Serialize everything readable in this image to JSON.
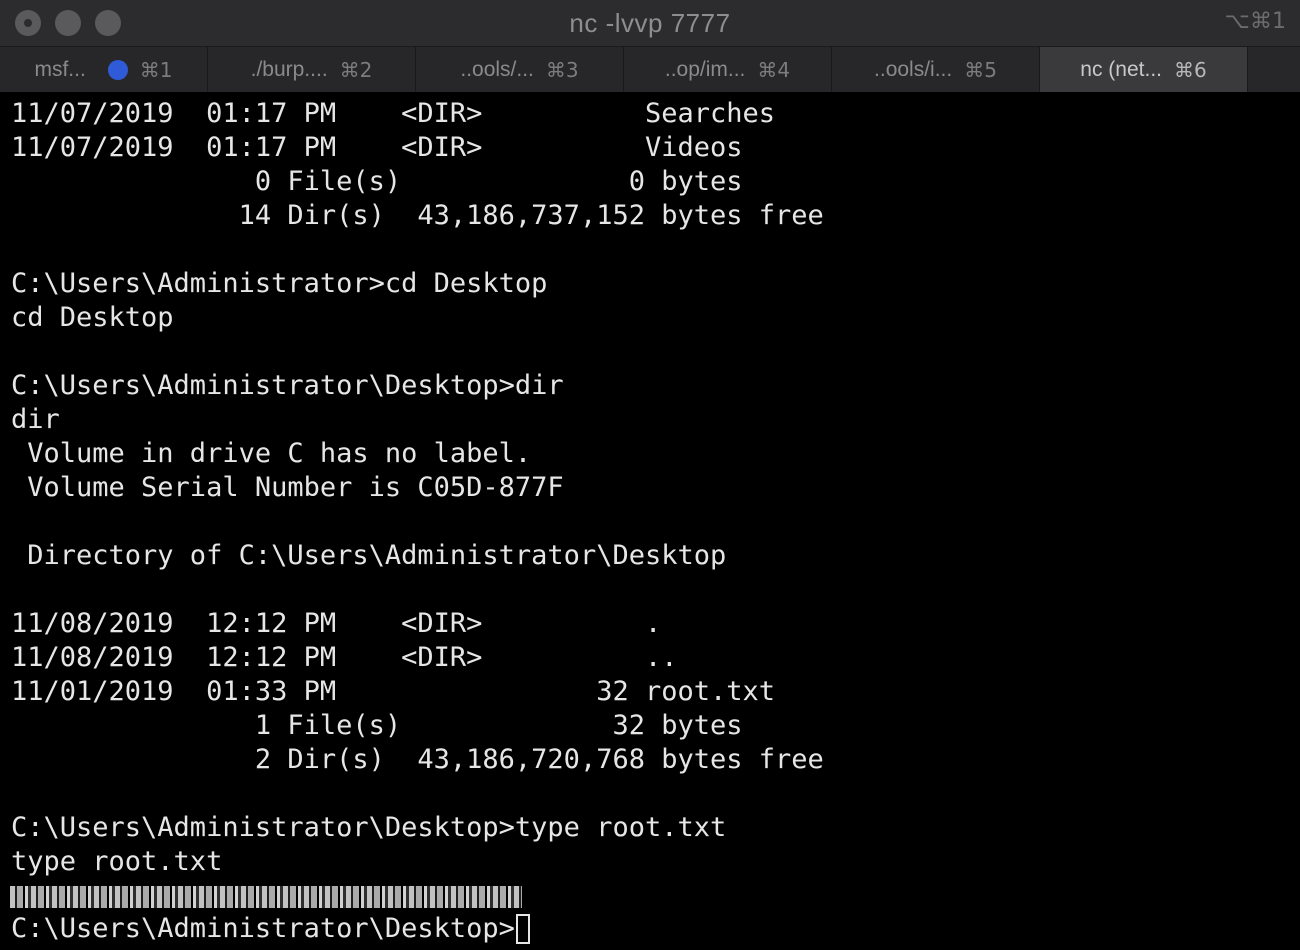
{
  "window": {
    "title": "nc -lvvp 7777",
    "shortcut": "⌥⌘1"
  },
  "tabs": [
    {
      "label": "msf...",
      "shortcut": "⌘1",
      "has_activity": true,
      "active": false
    },
    {
      "label": "./burp....",
      "shortcut": "⌘2",
      "has_activity": false,
      "active": false
    },
    {
      "label": "..ools/...",
      "shortcut": "⌘3",
      "has_activity": false,
      "active": false
    },
    {
      "label": "..op/im...",
      "shortcut": "⌘4",
      "has_activity": false,
      "active": false
    },
    {
      "label": "..ools/i...",
      "shortcut": "⌘5",
      "has_activity": false,
      "active": false
    },
    {
      "label": "nc (net...",
      "shortcut": "⌘6",
      "has_activity": false,
      "active": true
    }
  ],
  "terminal": {
    "lines": [
      "11/07/2019  01:17 PM    <DIR>          Searches",
      "11/07/2019  01:17 PM    <DIR>          Videos",
      "               0 File(s)              0 bytes",
      "              14 Dir(s)  43,186,737,152 bytes free",
      "",
      "C:\\Users\\Administrator>cd Desktop",
      "cd Desktop",
      "",
      "C:\\Users\\Administrator\\Desktop>dir",
      "dir",
      " Volume in drive C has no label.",
      " Volume Serial Number is C05D-877F",
      "",
      " Directory of C:\\Users\\Administrator\\Desktop",
      "",
      "11/08/2019  12:12 PM    <DIR>          .",
      "11/08/2019  12:12 PM    <DIR>          ..",
      "11/01/2019  01:33 PM                32 root.txt",
      "               1 File(s)             32 bytes",
      "               2 Dir(s)  43,186,720,768 bytes free",
      "",
      "C:\\Users\\Administrator\\Desktop>type root.txt",
      "type root.txt"
    ],
    "prompt": "C:\\Users\\Administrator\\Desktop>"
  },
  "colors": {
    "background": "#000000",
    "text": "#e6e6e6",
    "titlebar": "#2c2c2e",
    "activity_dot": "#2f5bd8"
  }
}
